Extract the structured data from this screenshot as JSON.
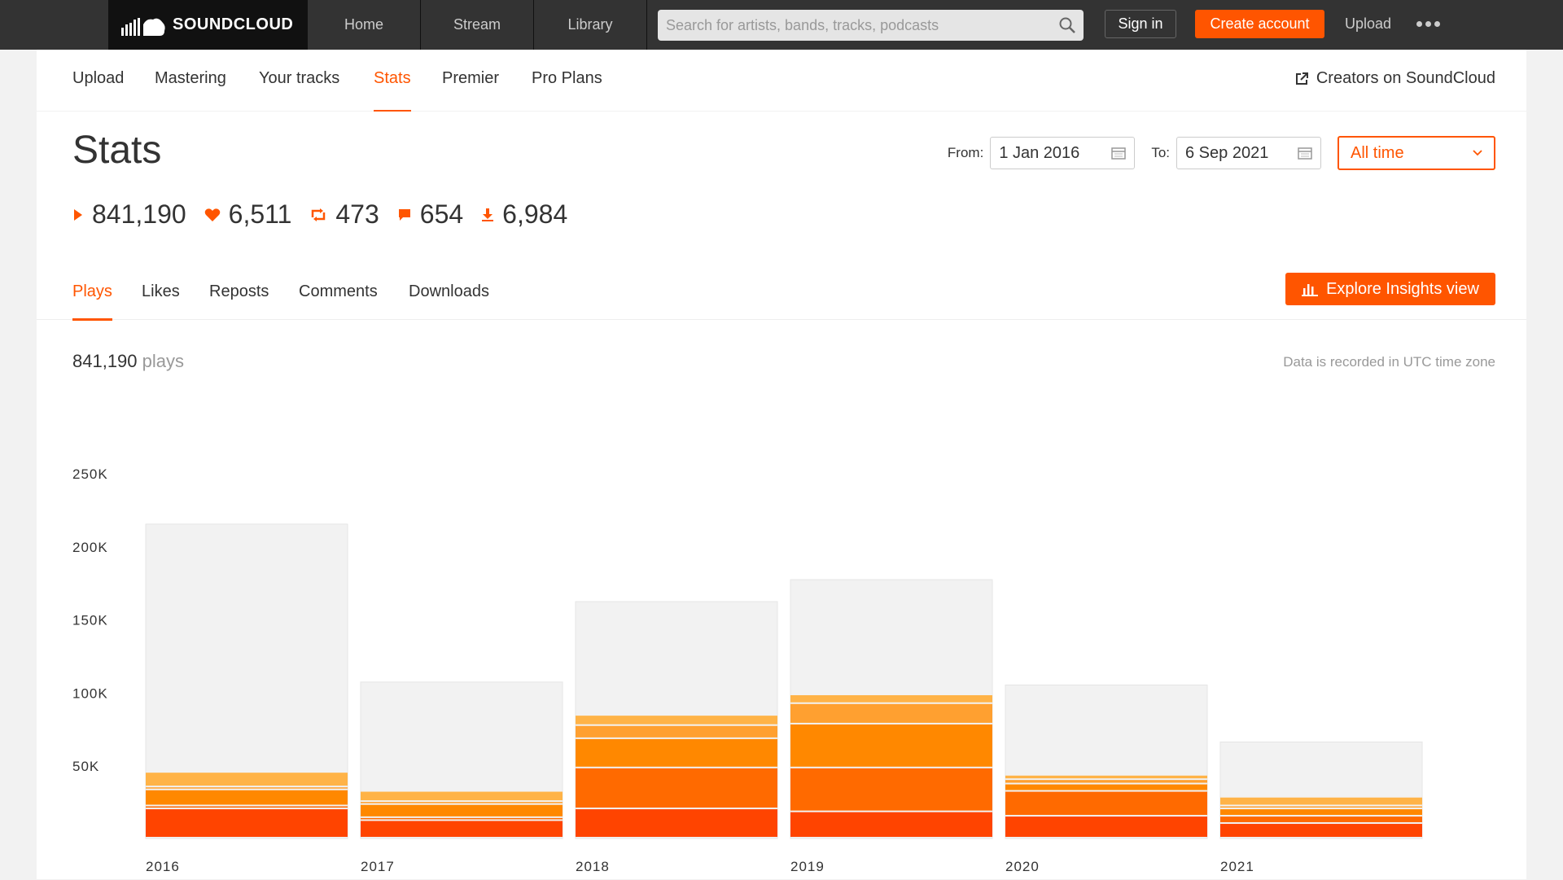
{
  "header": {
    "logo_text": "SOUNDCLOUD",
    "nav": [
      "Home",
      "Stream",
      "Library"
    ],
    "search_placeholder": "Search for artists, bands, tracks, podcasts",
    "sign_in": "Sign in",
    "create_account": "Create account",
    "upload": "Upload"
  },
  "subnav": {
    "items": [
      "Upload",
      "Mastering",
      "Your tracks",
      "Stats",
      "Premier",
      "Pro Plans"
    ],
    "active": "Stats",
    "creators_link": "Creators on SoundCloud"
  },
  "page": {
    "title": "Stats",
    "from_label": "From:",
    "from_value": "1 Jan 2016",
    "to_label": "To:",
    "to_value": "6 Sep 2021",
    "range_select": "All time"
  },
  "summary": {
    "plays": "841,190",
    "likes": "6,511",
    "reposts": "473",
    "comments": "654",
    "downloads": "6,984"
  },
  "tabs": {
    "items": [
      "Plays",
      "Likes",
      "Reposts",
      "Comments",
      "Downloads"
    ],
    "active": "Plays",
    "explore_button": "Explore Insights view"
  },
  "chart_header": {
    "total": "841,190",
    "unit": "plays",
    "utc_note": "Data is recorded in UTC time zone"
  },
  "colors": {
    "accent": "#ff5500",
    "bar_background": "#f2f2f2",
    "segment_1": "#ff4400",
    "segment_2": "#ff6a00",
    "segment_3": "#ff8800",
    "segment_4": "#ffa030",
    "segment_5": "#ffb347"
  },
  "chart_data": {
    "type": "bar",
    "title": "",
    "xlabel": "",
    "ylabel": "",
    "ylim": [
      0,
      250000
    ],
    "yticks": [
      50000,
      100000,
      150000,
      200000,
      250000
    ],
    "ytick_labels": [
      "50K",
      "100K",
      "150K",
      "200K",
      "250K"
    ],
    "categories": [
      "2016",
      "2017",
      "2018",
      "2019",
      "2020",
      "2021"
    ],
    "totals": [
      215000,
      107000,
      162000,
      177000,
      105000,
      66000
    ],
    "series": [
      {
        "values": [
          20000,
          12000,
          20000,
          18000,
          15000,
          10000
        ]
      },
      {
        "values": [
          2000,
          2000,
          28000,
          30000,
          17000,
          5000
        ]
      },
      {
        "values": [
          11000,
          9000,
          20000,
          30000,
          5000,
          5000
        ]
      },
      {
        "values": [
          2000,
          2000,
          9000,
          14000,
          3000,
          2000
        ]
      },
      {
        "values": [
          10000,
          7000,
          7000,
          6000,
          3000,
          6000
        ]
      }
    ]
  }
}
